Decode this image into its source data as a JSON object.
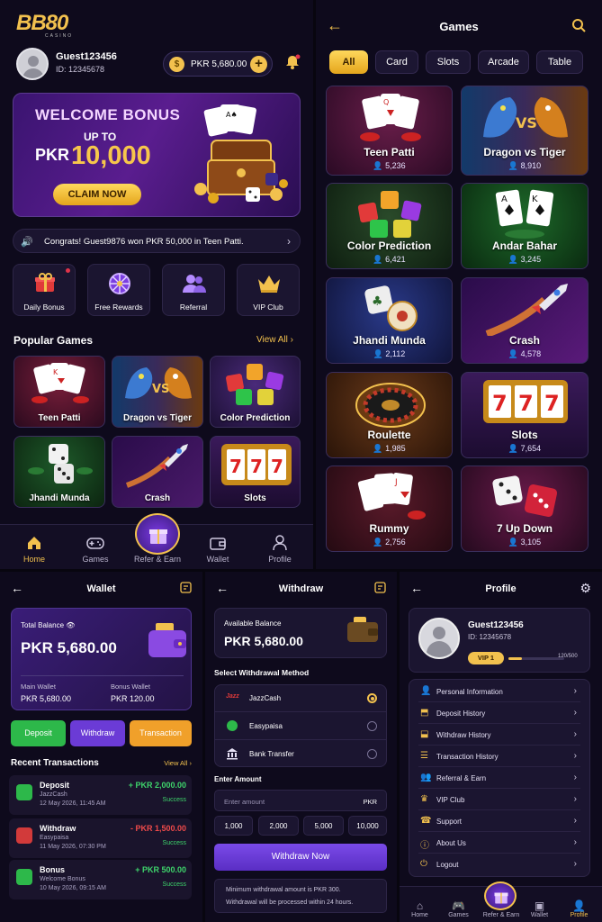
{
  "home": {
    "logo": "BB80",
    "logo_sub": "CASINO",
    "username": "Guest123456",
    "user_id": "ID: 12345678",
    "balance": "PKR 5,680.00",
    "banner": {
      "title": "WELCOME BONUS",
      "upto": "UP TO",
      "currency": "PKR",
      "amount": "10,000",
      "cta": "CLAIM NOW"
    },
    "ticker": "Congrats! Guest9876 won PKR 50,000 in Teen Patti.",
    "quick": [
      {
        "label": "Daily Bonus"
      },
      {
        "label": "Free Rewards"
      },
      {
        "label": "Referral"
      },
      {
        "label": "VIP Club"
      }
    ],
    "popular_title": "Popular Games",
    "view_all": "View All",
    "games": [
      {
        "name": "Teen Patti"
      },
      {
        "name": "Dragon vs Tiger"
      },
      {
        "name": "Color Prediction"
      },
      {
        "name": "Jhandi Munda"
      },
      {
        "name": "Crash"
      },
      {
        "name": "Slots"
      }
    ],
    "nav": [
      {
        "label": "Home"
      },
      {
        "label": "Games"
      },
      {
        "label": "Refer & Earn"
      },
      {
        "label": "Wallet"
      },
      {
        "label": "Profile"
      }
    ]
  },
  "games_screen": {
    "title": "Games",
    "filters": [
      {
        "label": "All"
      },
      {
        "label": "Card"
      },
      {
        "label": "Slots"
      },
      {
        "label": "Arcade"
      },
      {
        "label": "Table"
      }
    ],
    "games": [
      {
        "name": "Teen Patti",
        "players": "5,236"
      },
      {
        "name": "Dragon vs Tiger",
        "players": "8,910"
      },
      {
        "name": "Color Prediction",
        "players": "6,421"
      },
      {
        "name": "Andar Bahar",
        "players": "3,245"
      },
      {
        "name": "Jhandi Munda",
        "players": "2,112"
      },
      {
        "name": "Crash",
        "players": "4,578"
      },
      {
        "name": "Roulette",
        "players": "1,985"
      },
      {
        "name": "Slots",
        "players": "7,654"
      },
      {
        "name": "Rummy",
        "players": "2,756"
      },
      {
        "name": "7 Up Down",
        "players": "3,105"
      }
    ]
  },
  "wallet": {
    "title": "Wallet",
    "total_label": "Total Balance",
    "total": "PKR 5,680.00",
    "main_label": "Main Wallet",
    "main": "PKR 5,680.00",
    "bonus_label": "Bonus Wallet",
    "bonus": "PKR 120.00",
    "deposit": "Deposit",
    "withdraw": "Withdraw",
    "transaction": "Transaction",
    "recent": "Recent Transactions",
    "view_all": "View All",
    "tx": [
      {
        "type": "Deposit",
        "source": "JazzCash",
        "date": "12 May 2026, 11:45 AM",
        "amount": "+ PKR 2,000.00",
        "status": "Success"
      },
      {
        "type": "Withdraw",
        "source": "Easypaisa",
        "date": "11 May 2026, 07:30 PM",
        "amount": "- PKR 1,500.00",
        "status": "Success"
      },
      {
        "type": "Bonus",
        "source": "Welcome Bonus",
        "date": "10 May 2026, 09:15 AM",
        "amount": "+ PKR 500.00",
        "status": "Success"
      }
    ]
  },
  "withdraw": {
    "title": "Withdraw",
    "available_label": "Available Balance",
    "available": "PKR 5,680.00",
    "method_title": "Select Withdrawal Method",
    "methods": [
      {
        "name": "JazzCash"
      },
      {
        "name": "Easypaisa"
      },
      {
        "name": "Bank Transfer"
      }
    ],
    "amount_title": "Enter Amount",
    "amount_placeholder": "Enter amount",
    "currency": "PKR",
    "quick": [
      {
        "v": "1,000"
      },
      {
        "v": "2,000"
      },
      {
        "v": "5,000"
      },
      {
        "v": "10,000"
      }
    ],
    "cta": "Withdraw Now",
    "note1": "Minimum withdrawal amount is PKR 300.",
    "note2": "Withdrawal will be processed within 24 hours."
  },
  "profile": {
    "title": "Profile",
    "username": "Guest123456",
    "user_id": "ID: 12345678",
    "vip": "VIP 1",
    "progress": "120/500",
    "progress_frac": 0.24,
    "menu": [
      {
        "label": "Personal Information"
      },
      {
        "label": "Deposit History"
      },
      {
        "label": "Withdraw History"
      },
      {
        "label": "Transaction History"
      },
      {
        "label": "Referral & Earn"
      },
      {
        "label": "VIP Club"
      },
      {
        "label": "Support"
      },
      {
        "label": "About Us"
      },
      {
        "label": "Logout"
      }
    ],
    "nav": [
      {
        "label": "Home"
      },
      {
        "label": "Games"
      },
      {
        "label": "Refer & Earn"
      },
      {
        "label": "Wallet"
      },
      {
        "label": "Profile"
      }
    ]
  },
  "colors": {
    "accent": "#f2c14e",
    "purple": "#6b3bd6",
    "green": "#2db84a",
    "orange": "#f0a02a",
    "bg": "#0e0a1c"
  }
}
